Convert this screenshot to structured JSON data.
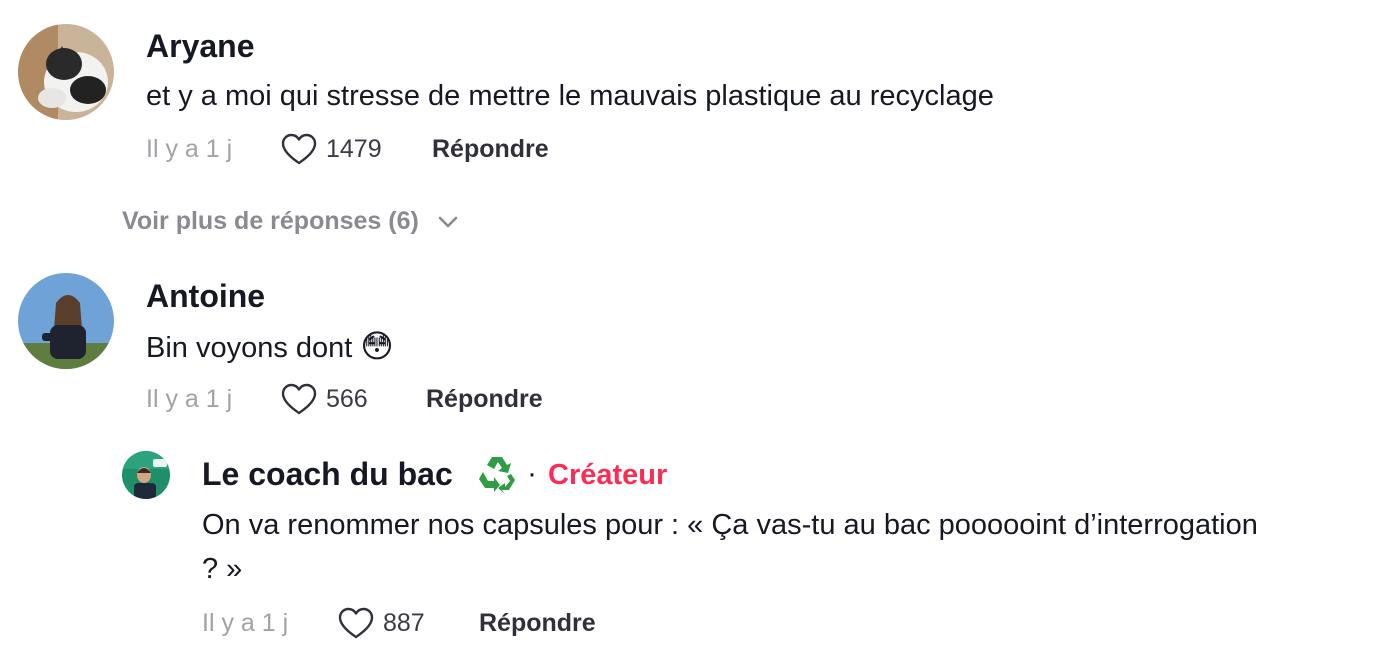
{
  "comments": [
    {
      "username": "Aryane",
      "text": "et y a moi qui stresse de mettre le mauvais plastique au recyclage",
      "time": "Il y a 1 j",
      "likes": "1479",
      "reply_label": "Répondre"
    },
    {
      "username": "Antoine",
      "text": "Bin voyons dont",
      "emoji": "😳",
      "time": "Il y a 1 j",
      "likes": "566",
      "reply_label": "Répondre"
    }
  ],
  "more_replies": {
    "label": "Voir plus de réponses (6)",
    "icon": "chevron-down-icon"
  },
  "reply": {
    "username": "Le coach du bac",
    "badge_icon": "recycle-icon",
    "separator": "·",
    "creator_label": "Créateur",
    "creator_color": "#fe2c55",
    "text_line1": "On va renommer nos capsules pour : « Ça vas-tu au bac poooooint d’interrogation",
    "text_line2": "? »",
    "time": "Il y a 1 j",
    "likes": "887",
    "reply_label": "Répondre"
  },
  "icons": {
    "like": "heart-outline-icon"
  },
  "colors": {
    "primary_text": "#161823",
    "muted_text": "#a1a2a7",
    "accent": "#fe2c55"
  }
}
